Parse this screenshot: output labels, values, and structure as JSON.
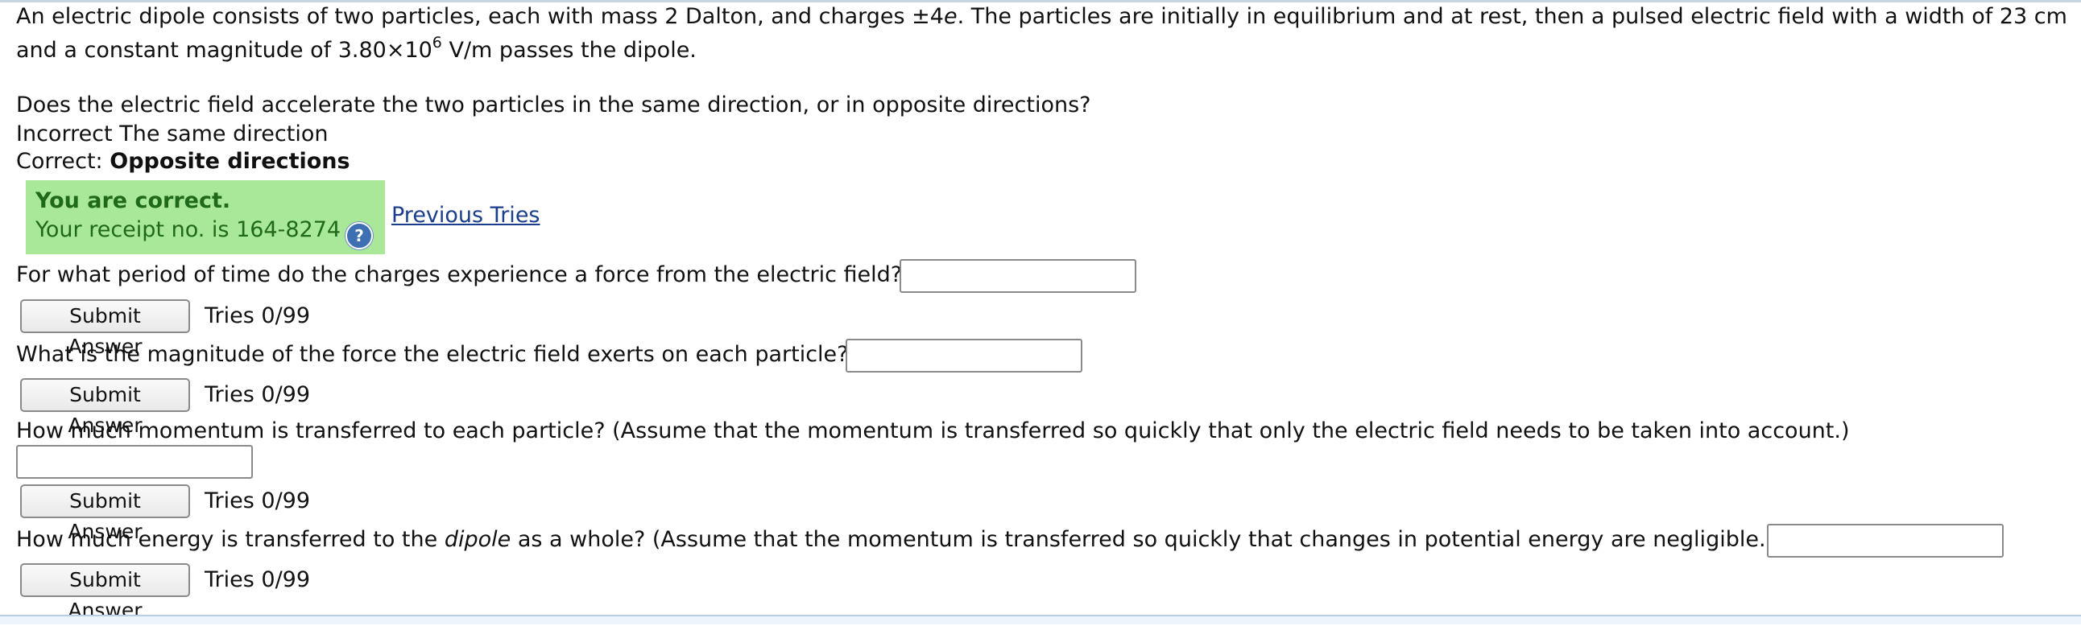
{
  "problem": {
    "intro_line1_a": "An electric dipole consists of two particles, each with mass 2 Dalton, and charges ±4",
    "intro_line1_e": "e",
    "intro_line1_b": ". The particles are initially in equilibrium and at rest, then a pulsed electric field with a width of 23 cm",
    "intro_line2_a": "and a constant magnitude of 3.80×10",
    "intro_line2_exp": "6",
    "intro_line2_b": " V/m passes the dipole."
  },
  "part1": {
    "question": "Does the electric field accelerate the two particles in the same direction, or in opposite directions?",
    "incorrect_label": "Incorrect",
    "incorrect_answer": "The same direction",
    "correct_label": "Correct:",
    "correct_answer": "Opposite directions",
    "status_text": "You are correct.",
    "receipt_text": "Your receipt no. is 164-8274",
    "help_glyph": "?",
    "previous_tries_label": "Previous Tries"
  },
  "part2": {
    "question": "For what period of time do the charges experience a force from the electric field?",
    "input_value": "",
    "submit_label": "Submit Answer",
    "tries": "Tries 0/99"
  },
  "part3": {
    "question": "What is the magnitude of the force the electric field exerts on each particle?",
    "input_value": "",
    "submit_label": "Submit Answer",
    "tries": "Tries 0/99"
  },
  "part4": {
    "question": "How much momentum is transferred to each particle? (Assume that the momentum is transferred so quickly that only the electric field needs to be taken into account.)",
    "input_value": "",
    "submit_label": "Submit Answer",
    "tries": "Tries 0/99"
  },
  "part5": {
    "question_a": "How much energy is transferred to the ",
    "question_italic": "dipole",
    "question_b": " as a whole? (Assume that the momentum is transferred so quickly that changes in potential energy are negligible.)",
    "input_value": "",
    "submit_label": "Submit Answer",
    "tries": "Tries 0/99"
  },
  "colors": {
    "status_bg": "#a8e898",
    "status_text": "#1f6a1a",
    "link": "#1a3d8c"
  },
  "icons": {
    "help": "help-icon"
  }
}
